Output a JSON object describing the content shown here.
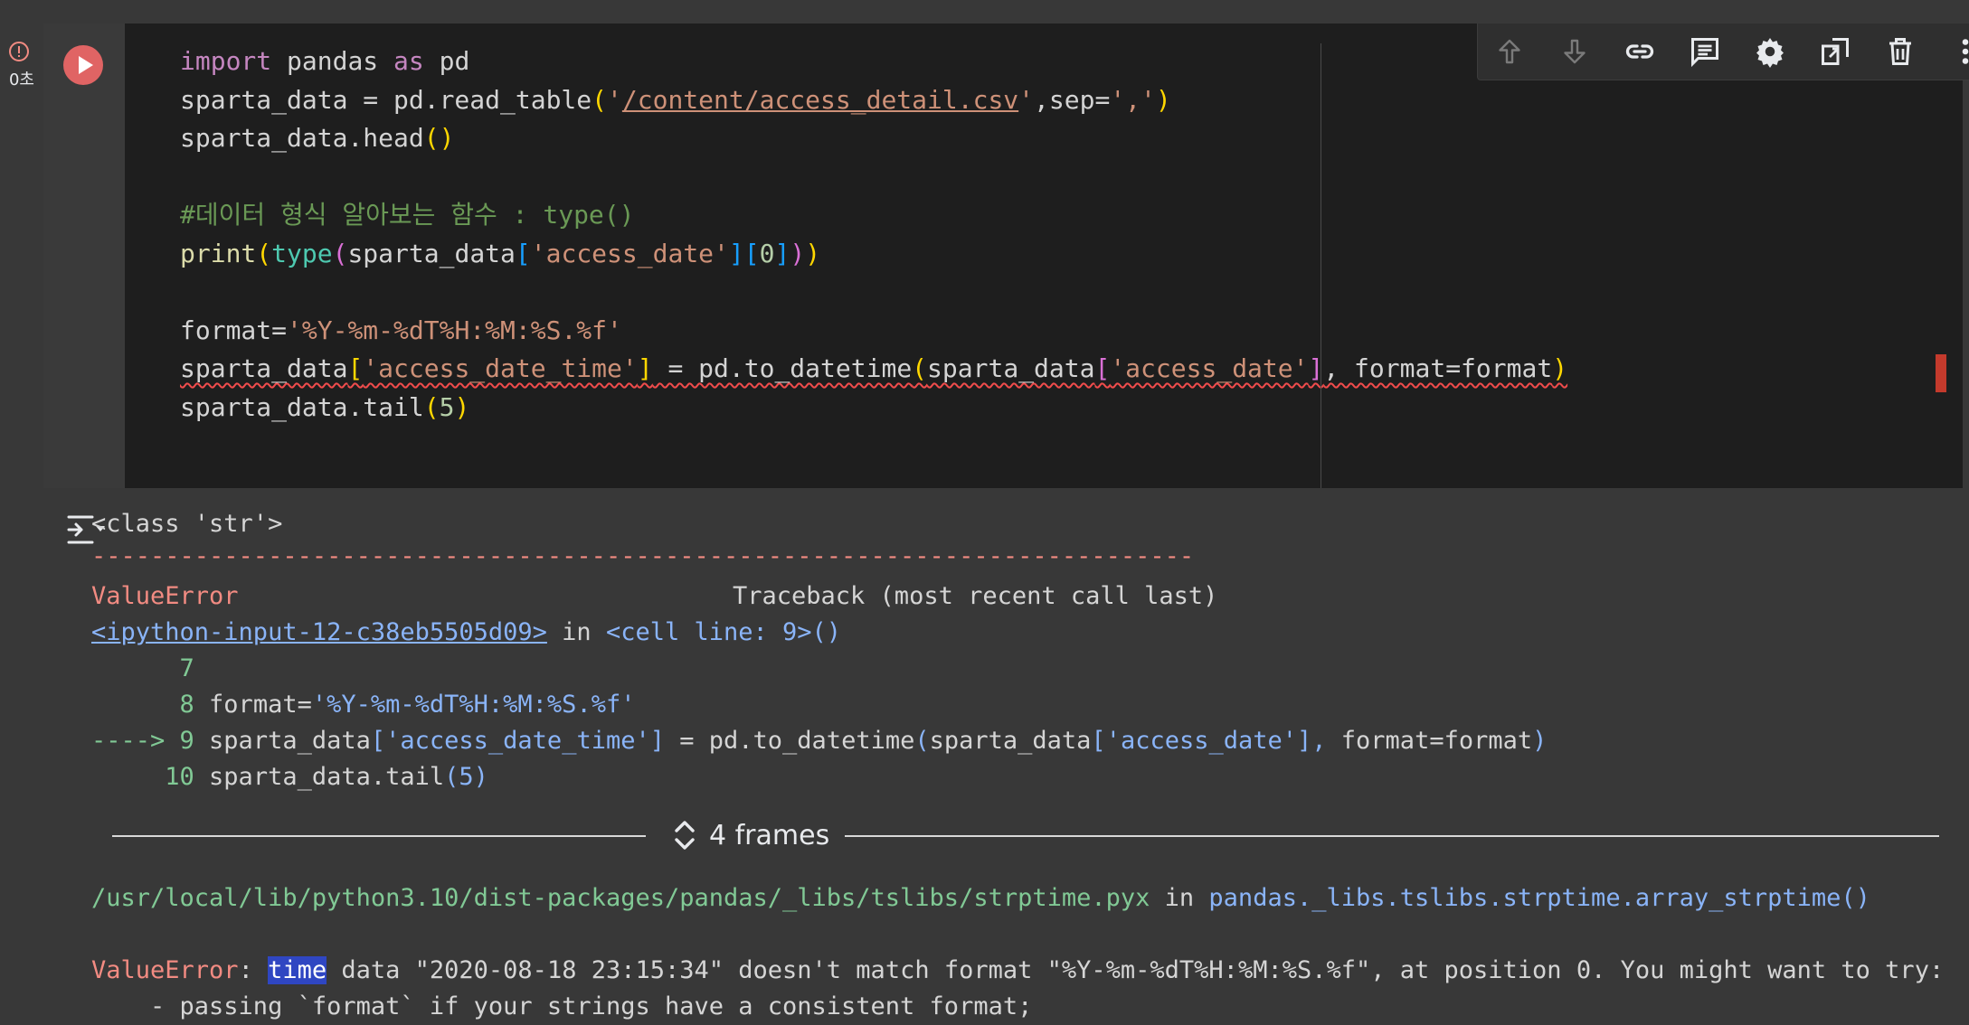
{
  "cell": {
    "exec_time": "0초",
    "code_lines": [
      [
        {
          "t": "import",
          "c": "kw"
        },
        {
          "t": " pandas "
        },
        {
          "t": "as",
          "c": "kw"
        },
        {
          "t": " pd"
        }
      ],
      [
        {
          "t": "sparta_data = pd.read_table"
        },
        {
          "t": "(",
          "c": "p1"
        },
        {
          "t": "'",
          "c": "str"
        },
        {
          "t": "/content/access_detail.csv",
          "c": "str str-link"
        },
        {
          "t": "'",
          "c": "str"
        },
        {
          "t": ",sep="
        },
        {
          "t": "','",
          "c": "str"
        },
        {
          "t": ")",
          "c": "p1"
        }
      ],
      [
        {
          "t": "sparta_data.head"
        },
        {
          "t": "()",
          "c": "p1"
        }
      ],
      [],
      [
        {
          "t": "#데이터 형식 알아보는 함수 : type()",
          "c": "cmt"
        }
      ],
      [
        {
          "t": "print",
          "c": "fn"
        },
        {
          "t": "(",
          "c": "p1"
        },
        {
          "t": "type",
          "c": "bi"
        },
        {
          "t": "(",
          "c": "p2"
        },
        {
          "t": "sparta_data"
        },
        {
          "t": "[",
          "c": "p3"
        },
        {
          "t": "'access_date'",
          "c": "str"
        },
        {
          "t": "][",
          "c": "p3"
        },
        {
          "t": "0",
          "c": "num"
        },
        {
          "t": "]",
          "c": "p3"
        },
        {
          "t": ")",
          "c": "p2"
        },
        {
          "t": ")",
          "c": "p1"
        }
      ],
      [],
      [
        {
          "t": "format="
        },
        {
          "t": "'%Y-%m-%dT%H:%M:%S.%f'",
          "c": "str"
        }
      ],
      [
        {
          "t": "sparta_data",
          "c": "squig"
        },
        {
          "t": "[",
          "c": "p1 squig"
        },
        {
          "t": "'access_date_time'",
          "c": "str squig"
        },
        {
          "t": "]",
          "c": "p1 squig"
        },
        {
          "t": " = pd.to_datetime",
          "c": "squig"
        },
        {
          "t": "(",
          "c": "p1 squig"
        },
        {
          "t": "sparta_data",
          "c": "squig"
        },
        {
          "t": "[",
          "c": "p2 squig"
        },
        {
          "t": "'access_date'",
          "c": "str squig"
        },
        {
          "t": "]",
          "c": "p2 squig"
        },
        {
          "t": ", format=format",
          "c": "squig"
        },
        {
          "t": ")",
          "c": "p1 squig"
        }
      ],
      [
        {
          "t": "sparta_data.tail"
        },
        {
          "t": "(",
          "c": "p1"
        },
        {
          "t": "5",
          "c": "num"
        },
        {
          "t": ")",
          "c": "p1"
        }
      ]
    ]
  },
  "toolbar": {
    "icons": [
      "arrow-up-icon",
      "arrow-down-icon",
      "link-icon",
      "comment-icon",
      "gear-icon",
      "mirror-cell-icon",
      "trash-icon",
      "more-vert-icon"
    ]
  },
  "output": {
    "class_line": "<class 'str'>",
    "separator": "---------------------------------------------------------------------------",
    "error_name": "ValueError",
    "traceback_header": "Traceback (most recent call last)",
    "input_link": "<ipython-input-12-c38eb5505d09>",
    "in_text": " in ",
    "cell_line": "<cell line: 9>()",
    "tb_lines": [
      [
        {
          "t": "      7",
          "c": "green"
        }
      ],
      [
        {
          "t": "      8 ",
          "c": "green"
        },
        {
          "t": "format="
        },
        {
          "t": "'%Y-%m-%dT%H:%M:%S.%f'",
          "c": "blue"
        }
      ],
      [
        {
          "t": "----> 9 ",
          "c": "green"
        },
        {
          "t": "sparta_data"
        },
        {
          "t": "[",
          "c": "blue"
        },
        {
          "t": "'access_date_time'",
          "c": "blue"
        },
        {
          "t": "]",
          "c": "blue"
        },
        {
          "t": " = pd.to_datetime"
        },
        {
          "t": "(",
          "c": "blue"
        },
        {
          "t": "sparta_data"
        },
        {
          "t": "[",
          "c": "blue"
        },
        {
          "t": "'access_date'",
          "c": "blue"
        },
        {
          "t": "],",
          "c": "blue"
        },
        {
          "t": " format=format"
        },
        {
          "t": ")",
          "c": "blue"
        }
      ],
      [
        {
          "t": "     10 ",
          "c": "green"
        },
        {
          "t": "sparta_data.tail"
        },
        {
          "t": "(5)",
          "c": "blue"
        }
      ]
    ],
    "frames_label": "4 frames",
    "lib_path": "/usr/local/lib/python3.10/dist-packages/pandas/_libs/tslibs/strptime.pyx",
    "lib_in": " in ",
    "lib_func": "pandas._libs.tslibs.strptime.array_strptime()",
    "err_colon": ": ",
    "err_highlight": "time",
    "err_rest": " data \"2020-08-18 23:15:34\" doesn't match format \"%Y-%m-%dT%H:%M:%S.%f\", at position 0. You might want to try:",
    "err_cont": "    - passing `format` if your strings have a consistent format;"
  },
  "colors": {
    "run": "#e06464",
    "error": "#f28b82",
    "link": "#8ab4f8",
    "highlight": "#2f46c2"
  }
}
